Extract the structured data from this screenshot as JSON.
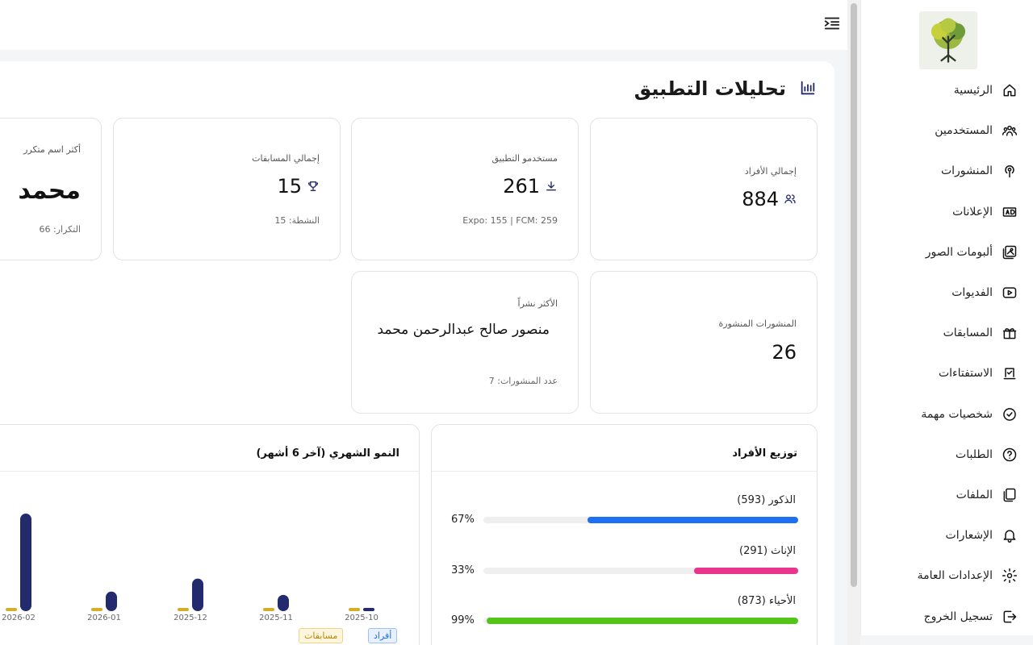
{
  "sidebar": {
    "logo_icon": "tree-logo",
    "items": [
      {
        "label": "الرئيسية",
        "icon": "home-icon"
      },
      {
        "label": "المستخدمين",
        "icon": "users-group-icon"
      },
      {
        "label": "المنشورات",
        "icon": "podcast-icon"
      },
      {
        "label": "الإعلانات",
        "icon": "ad-icon"
      },
      {
        "label": "ألبومات الصور",
        "icon": "photo-album-icon"
      },
      {
        "label": "الفديوات",
        "icon": "video-icon"
      },
      {
        "label": "المسابقات",
        "icon": "gift-icon"
      },
      {
        "label": "الاستفتاءات",
        "icon": "poll-icon"
      },
      {
        "label": "شخصيات مهمة",
        "icon": "badge-check-icon"
      },
      {
        "label": "الطلبات",
        "icon": "question-icon"
      },
      {
        "label": "الملفات",
        "icon": "files-icon"
      },
      {
        "label": "الإشعارات",
        "icon": "bell-icon"
      },
      {
        "label": "الإعدادات العامة",
        "icon": "gear-icon"
      },
      {
        "label": "تسجيل الخروج",
        "icon": "logout-icon"
      }
    ]
  },
  "header": {
    "menu_icon": "indent-menu-icon",
    "page_title": "تحليلات التطبيق",
    "page_icon": "bar-chart-icon"
  },
  "stats": {
    "total_members": {
      "label": "إجمالي الأفراد",
      "value": "884",
      "icon": "users-icon"
    },
    "app_users": {
      "label": "مستخدمو التطبيق",
      "value": "261",
      "icon": "download-icon",
      "sub": "Expo: 155 | FCM: 259"
    },
    "total_contests": {
      "label": "إجمالي المسابقات",
      "value": "15",
      "icon": "trophy-icon",
      "sub": "النشطة: 15"
    },
    "top_name": {
      "label": "أكثر اسم متكرر",
      "value": "محمد",
      "sub": "التكرار: 66"
    },
    "published_posts": {
      "label": "المنشورات المنشورة",
      "value": "26"
    },
    "top_poster": {
      "label": "الأكثر نشراً",
      "value": "منصور صالح عبدالرحمن محمد",
      "sub": "عدد المنشورات: 7"
    }
  },
  "distribution": {
    "title": "توزيع الأفراد",
    "rows": [
      {
        "label": "الذكور (593)",
        "pct": "67%",
        "fraction": 0.67,
        "color": "#1e6ff1"
      },
      {
        "label": "الإناث (291)",
        "pct": "33%",
        "fraction": 0.33,
        "color": "#e8368f"
      },
      {
        "label": "الأحياء (873)",
        "pct": "99%",
        "fraction": 0.99,
        "color": "#52c41a"
      }
    ]
  },
  "chart_data": {
    "type": "bar",
    "title": "النمو الشهري (آخر 6 أشهر)",
    "categories": [
      "2025-10",
      "2025-11",
      "2025-12",
      "2026-01",
      "2026-02"
    ],
    "series": [
      {
        "name": "أفراد",
        "color": "#232a6e",
        "values": [
          1,
          5,
          10,
          6,
          30
        ]
      },
      {
        "name": "مسابقات",
        "color": "#d4ae2b",
        "values": [
          0,
          0,
          0,
          0,
          1
        ]
      }
    ],
    "ylim": [
      0,
      31
    ],
    "legend": "bottom-right"
  }
}
